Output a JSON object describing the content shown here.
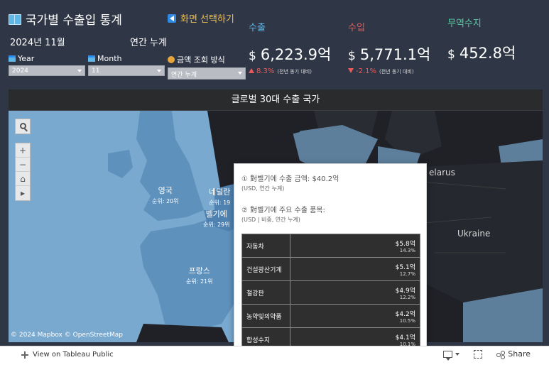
{
  "header": {
    "title": "국가별 수출입 통계",
    "screen_select": "화면 선택하기",
    "date_label": "2024년 11월",
    "cum_label": "연간 누계"
  },
  "filters": {
    "year": {
      "label": "Year",
      "value": "2024"
    },
    "month": {
      "label": "Month",
      "value": "11"
    },
    "method": {
      "label": "금액 조회 방식",
      "value": "연간 누계"
    }
  },
  "kpis": {
    "export": {
      "label": "수출",
      "currency": "$",
      "value": "6,223.9억",
      "change": "8.3%",
      "note": "(전년 동기 대비)",
      "label_color": "#5fb7e8"
    },
    "import": {
      "label": "수입",
      "currency": "$",
      "value": "5,771.1억",
      "change": "-2.1%",
      "note": "(전년 동기 대비)",
      "label_color": "#e85a5a"
    },
    "balance": {
      "label": "무역수지",
      "currency": "$",
      "value": "452.8억",
      "label_color": "#58c9a0"
    }
  },
  "map": {
    "header": "글로벌 30대 수출 국가",
    "labels": [
      {
        "name": "영국",
        "rank": "순위: 20위"
      },
      {
        "name": "네덜란",
        "rank": "순위: 19"
      },
      {
        "name": "벨기에",
        "rank": "순위: 29위"
      },
      {
        "name": "프랑스",
        "rank": "순위: 21위"
      }
    ],
    "belarus": "elarus",
    "ukraine": "Ukraine",
    "attribution": "© 2024 Mapbox  © OpenStreetMap",
    "controls": {
      "plus": "+",
      "minus": "−",
      "home": "⌂",
      "play": "▸"
    }
  },
  "tooltip": {
    "line1": "① 對벨기에 수출 금액: $40.2억",
    "line1_sub": "(USD,  연간 누계)",
    "line2": "② 對벨기에 주요 수출 품목:",
    "line2_sub": "(USD | 비중,  연간 누계)",
    "rows": [
      {
        "name": "자동차",
        "value": "$5.8억",
        "pct": "14.3%"
      },
      {
        "name": "건설광산기계",
        "value": "$5.1억",
        "pct": "12.7%"
      },
      {
        "name": "철강판",
        "value": "$4.9억",
        "pct": "12.2%"
      },
      {
        "name": "농약및의약품",
        "value": "$4.2억",
        "pct": "10.5%"
      },
      {
        "name": "합성수지",
        "value": "$4.1억",
        "pct": "10.1%"
      }
    ]
  },
  "footer": {
    "tableau_link": "View on Tableau Public",
    "share": "Share"
  }
}
